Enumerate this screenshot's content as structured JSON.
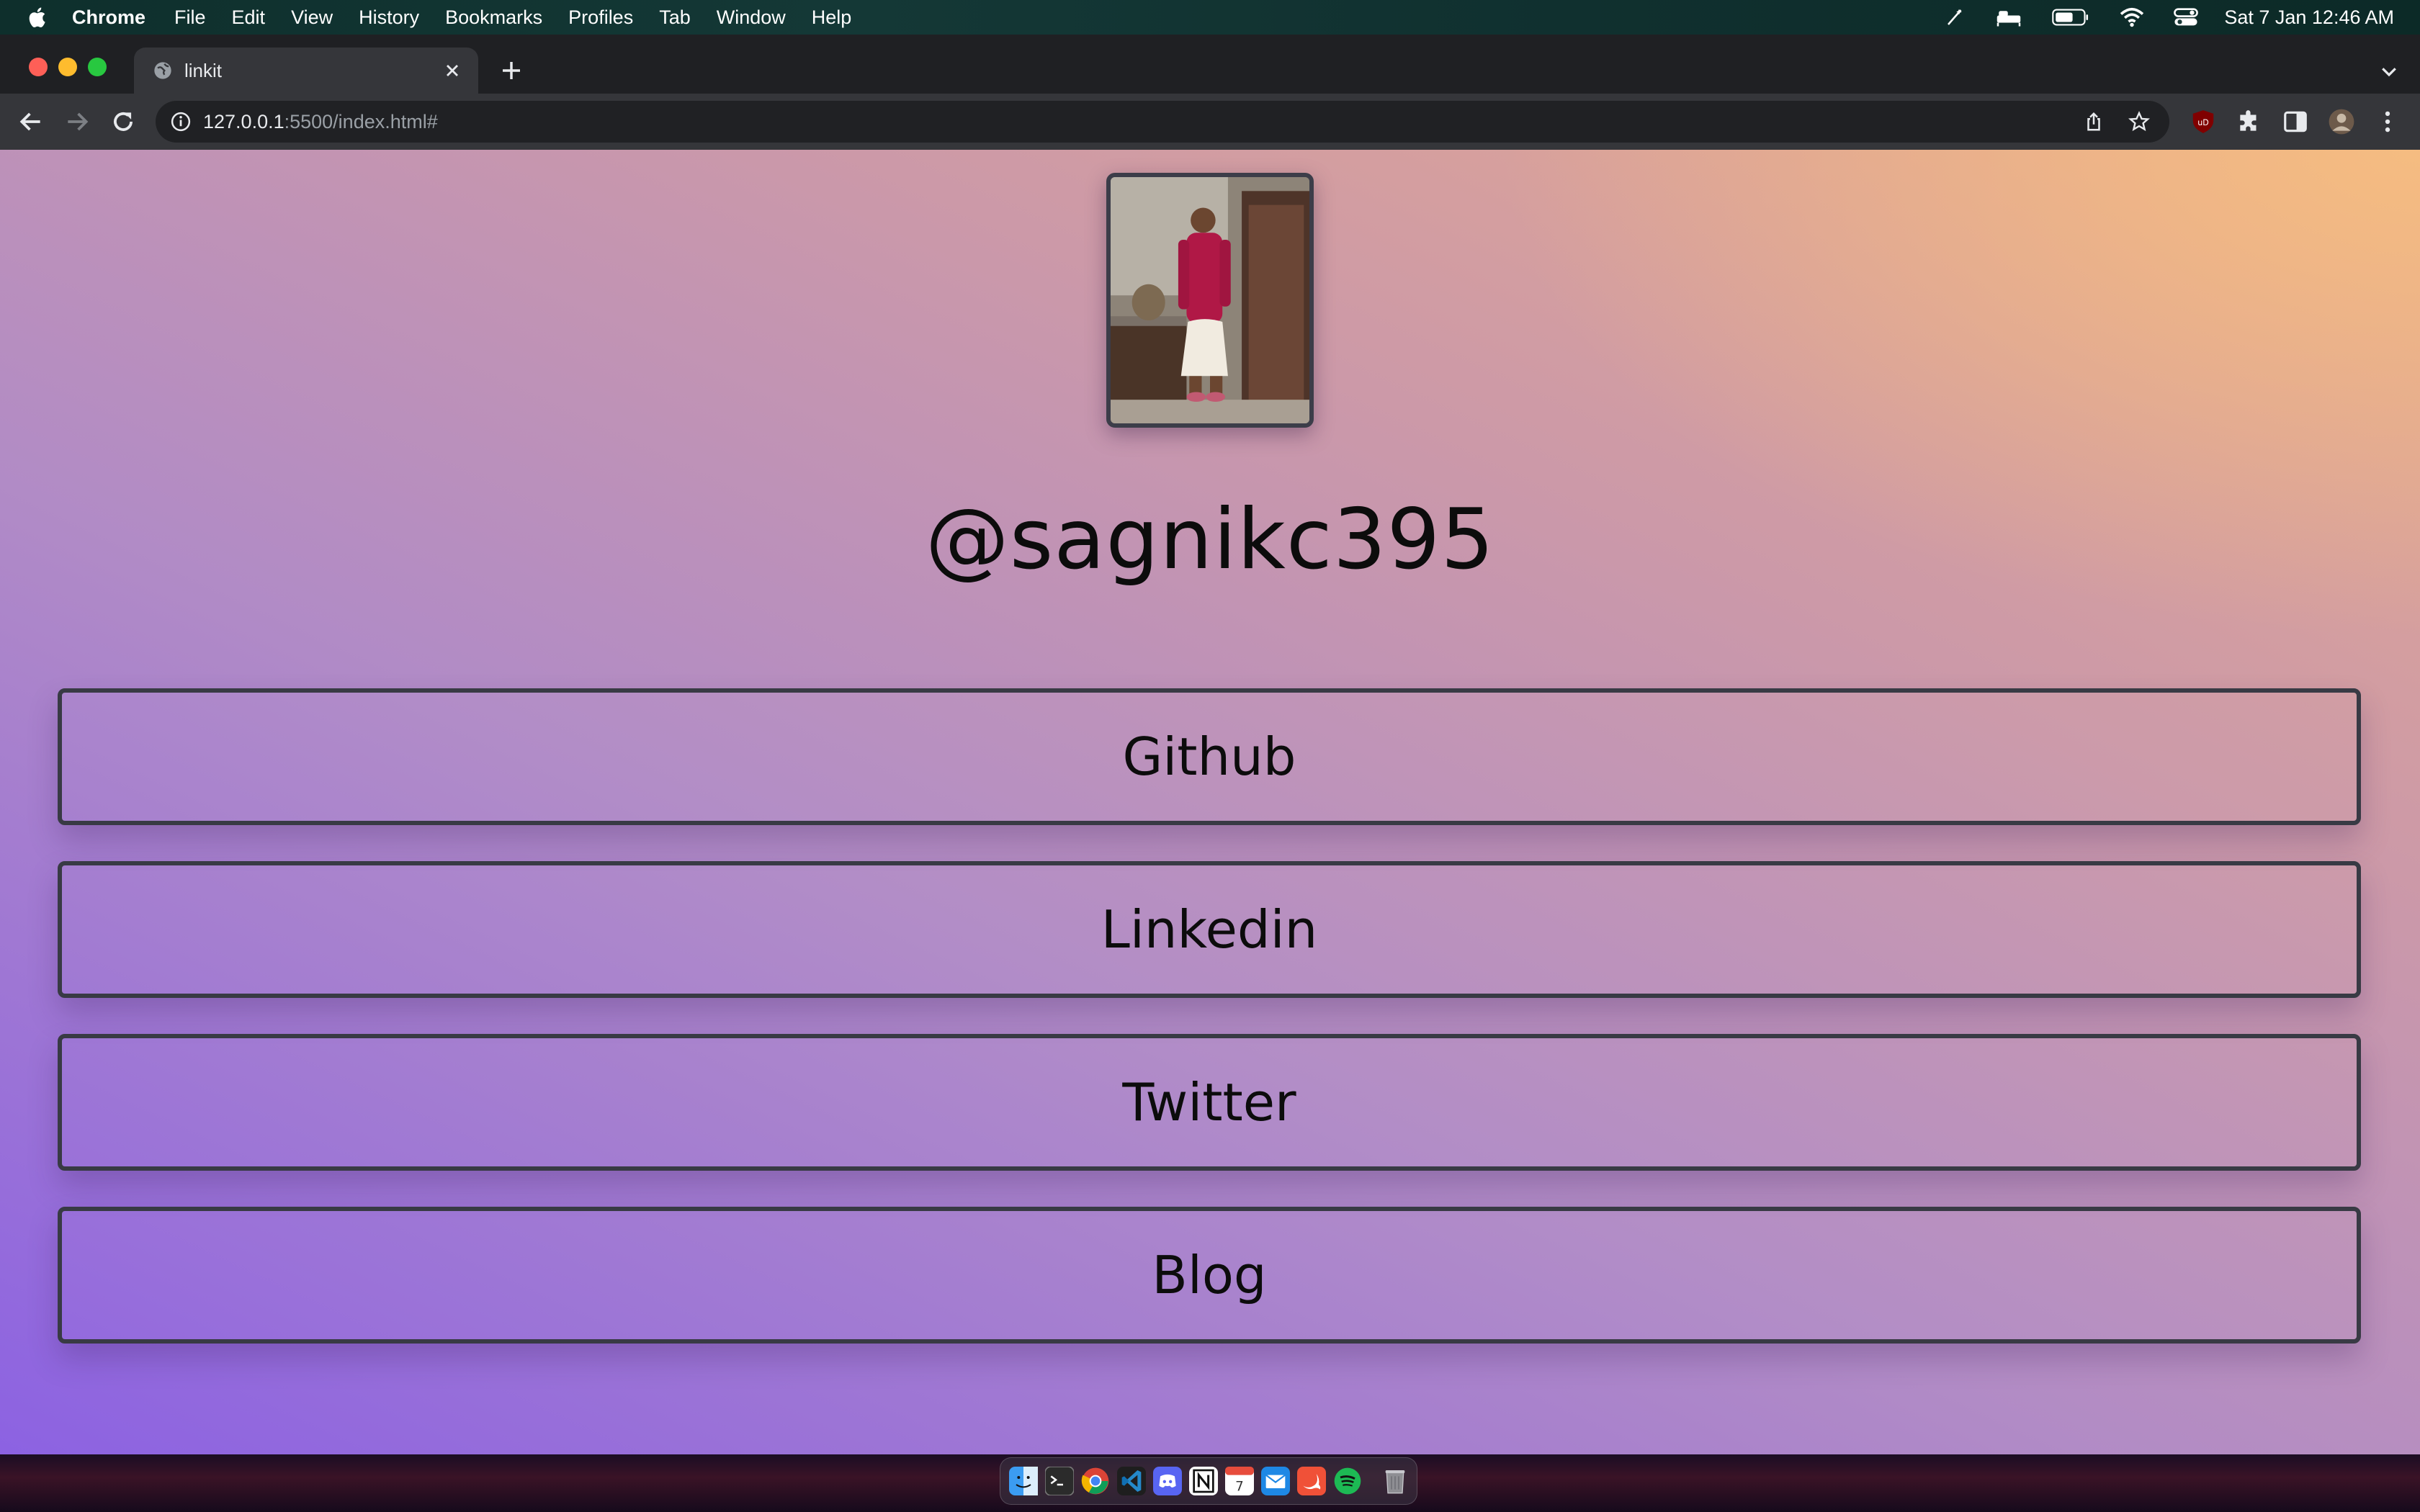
{
  "menubar": {
    "app_name": "Chrome",
    "items": [
      "File",
      "Edit",
      "View",
      "History",
      "Bookmarks",
      "Profiles",
      "Tab",
      "Window",
      "Help"
    ],
    "clock": "Sat 7 Jan  12:46 AM"
  },
  "browser": {
    "tab_title": "linkit",
    "url_host": "127.0.0.1",
    "url_path": ":5500/index.html#"
  },
  "page": {
    "handle": "@sagnikc395",
    "links": [
      {
        "label": "Github"
      },
      {
        "label": "Linkedin"
      },
      {
        "label": "Twitter"
      },
      {
        "label": "Blog"
      }
    ]
  },
  "dock": {
    "apps": [
      "finder-icon",
      "terminal-icon",
      "chrome-icon",
      "vscode-icon",
      "discord-icon",
      "notion-icon",
      "calendar-icon",
      "mail-icon",
      "swift-icon",
      "spotify-icon",
      "trash-icon"
    ],
    "calendar_day": "7"
  }
}
